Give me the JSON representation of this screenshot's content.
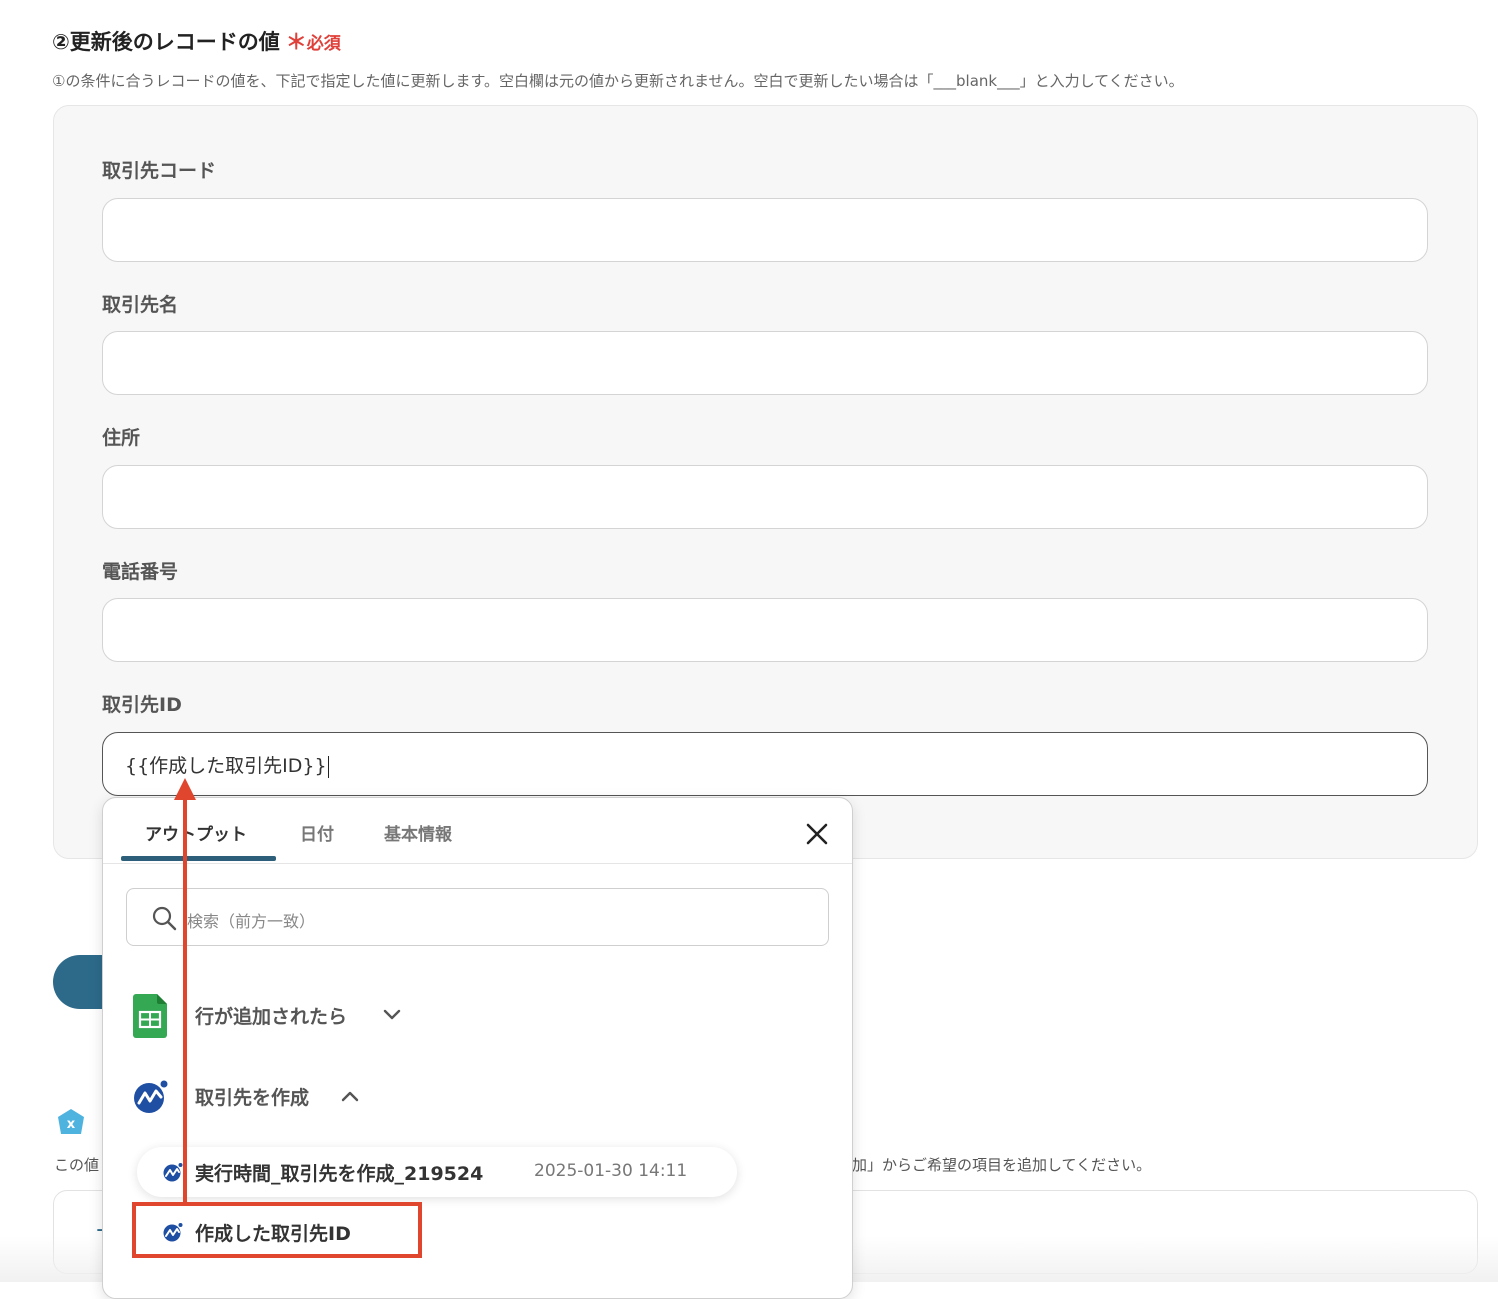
{
  "section": {
    "title": "②更新後のレコードの値",
    "required_star": "＊",
    "required_label": "必須",
    "description": "①の条件に合うレコードの値を、下記で指定した値に更新します。空白欄は元の値から更新されません。空白で更新したい場合は「___blank___」と入力してください。"
  },
  "fields": [
    {
      "label": "取引先コード",
      "value": ""
    },
    {
      "label": "取引先名",
      "value": ""
    },
    {
      "label": "住所",
      "value": ""
    },
    {
      "label": "電話番号",
      "value": ""
    },
    {
      "label": "取引先ID",
      "value": "{{作成した取引先ID}}"
    }
  ],
  "dropdown": {
    "tabs": [
      "アウトプット",
      "日付",
      "基本情報"
    ],
    "active_tab": "アウトプット",
    "search_placeholder": "検索（前方一致）",
    "groups": [
      {
        "label": "行が追加されたら",
        "expanded": false,
        "icon": "google-sheets-icon"
      },
      {
        "label": "取引先を作成",
        "expanded": true,
        "icon": "app-logo-icon"
      }
    ],
    "items": [
      {
        "label": "実行時間_取引先を作成_219524",
        "value": "2025-01-30 14:11"
      },
      {
        "label": "作成した取引先ID",
        "value": ""
      }
    ]
  },
  "background": {
    "hint_text_left": "この値",
    "hint_text_right": "加」からご希望の項目を追加してください。",
    "bottom_plus": "+"
  },
  "colors": {
    "accent": "#2d5f7a",
    "required": "#e0403a",
    "annotation": "#e0462e",
    "sheets_green": "#34a853"
  }
}
